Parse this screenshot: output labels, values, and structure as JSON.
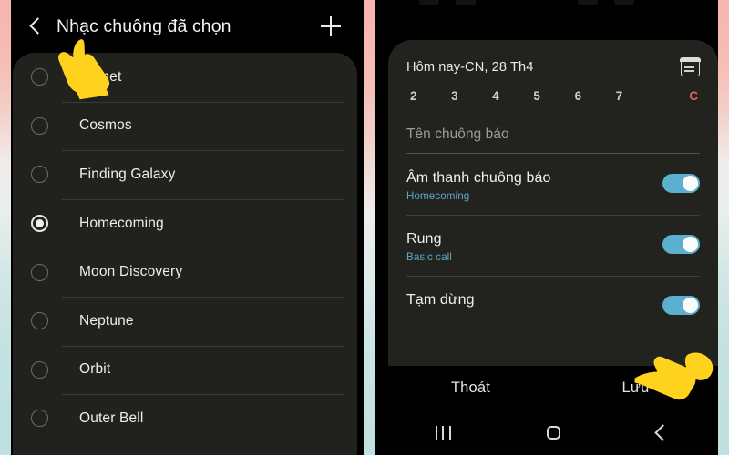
{
  "left_phone": {
    "app_bar": {
      "back_icon": "chevron-left-icon",
      "title": "Nhạc chuông đã chọn",
      "add_icon": "plus-icon"
    },
    "ringtones": [
      {
        "label": "Comet",
        "selected": false
      },
      {
        "label": "Cosmos",
        "selected": false
      },
      {
        "label": "Finding Galaxy",
        "selected": false
      },
      {
        "label": "Homecoming",
        "selected": true
      },
      {
        "label": "Moon Discovery",
        "selected": false
      },
      {
        "label": "Neptune",
        "selected": false
      },
      {
        "label": "Orbit",
        "selected": false
      },
      {
        "label": "Outer Bell",
        "selected": false
      }
    ]
  },
  "right_phone": {
    "alarm": {
      "date_label": "Hôm nay-CN, 28 Th4",
      "calendar_icon": "calendar-icon",
      "days": [
        {
          "label": "2",
          "sunday": false
        },
        {
          "label": "3",
          "sunday": false
        },
        {
          "label": "4",
          "sunday": false
        },
        {
          "label": "5",
          "sunday": false
        },
        {
          "label": "6",
          "sunday": false
        },
        {
          "label": "7",
          "sunday": false
        },
        {
          "label": "C",
          "sunday": true
        }
      ],
      "name_field": {
        "placeholder": "Tên chuông báo",
        "value": ""
      },
      "settings": [
        {
          "title": "Âm thanh chuông báo",
          "subtitle": "Homecoming",
          "toggle_on": true
        },
        {
          "title": "Rung",
          "subtitle": "Basic call",
          "toggle_on": true
        },
        {
          "title": "Tạm dừng",
          "subtitle": "",
          "toggle_on": true
        }
      ]
    },
    "actions": {
      "cancel_label": "Thoát",
      "save_label": "Lưu"
    },
    "nav_bar": {
      "recents_icon": "recents-icon",
      "home_icon": "home-icon",
      "back_icon": "back-icon"
    }
  },
  "cursors": [
    {
      "name": "pointing-hand-left",
      "icon": "pointing-hand-icon"
    },
    {
      "name": "pointing-hand-right",
      "icon": "pointing-hand-icon"
    }
  ],
  "colors": {
    "accent_toggle": "#5cb0cf",
    "subtitle_blue": "#5fa8c4",
    "sunday_red": "#d2675a",
    "card_bg": "#21211e",
    "screen_bg": "#000000",
    "cursor_yellow": "#ffd21e"
  }
}
